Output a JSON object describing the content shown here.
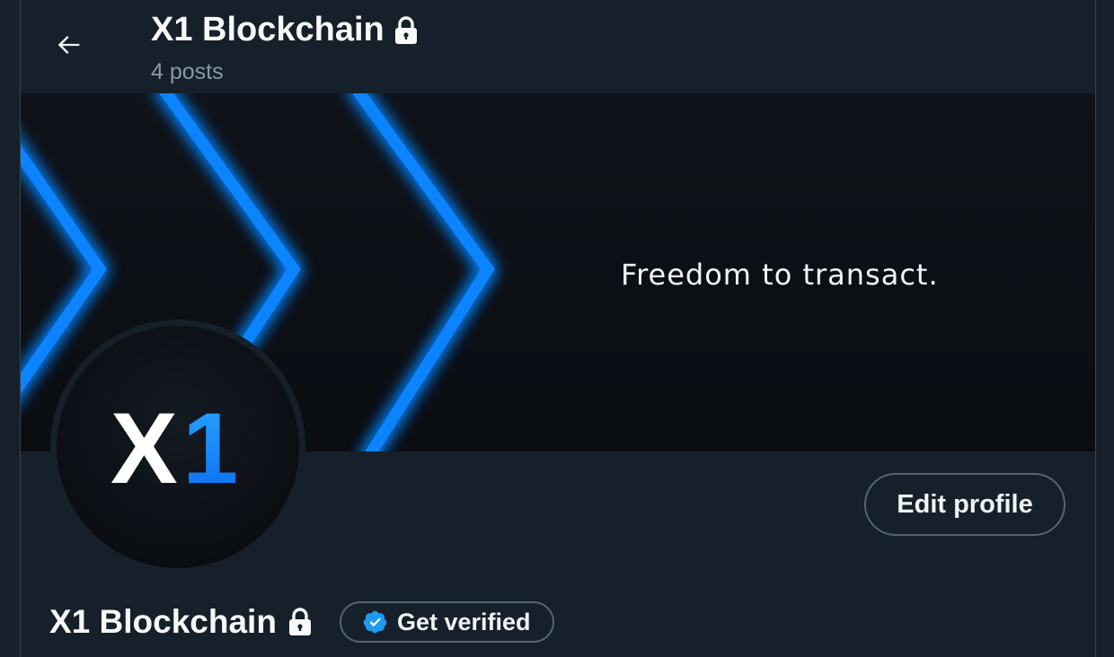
{
  "header": {
    "title": "X1 Blockchain",
    "posts_count": "4 posts"
  },
  "banner": {
    "tagline": "Freedom to transact."
  },
  "avatar": {
    "logo_text_x": "X",
    "logo_text_1": "1"
  },
  "profile": {
    "edit_label": "Edit profile",
    "name": "X1 Blockchain",
    "verify_label": "Get verified"
  },
  "icons": {
    "back": "arrow-left-icon",
    "lock": "lock-icon",
    "verified": "verified-badge-icon"
  },
  "colors": {
    "background": "#15202b",
    "accent_blue": "#1d9bf0",
    "neon_blue": "#0a84ff",
    "muted_text": "#8b98a5",
    "border": "#536471"
  }
}
